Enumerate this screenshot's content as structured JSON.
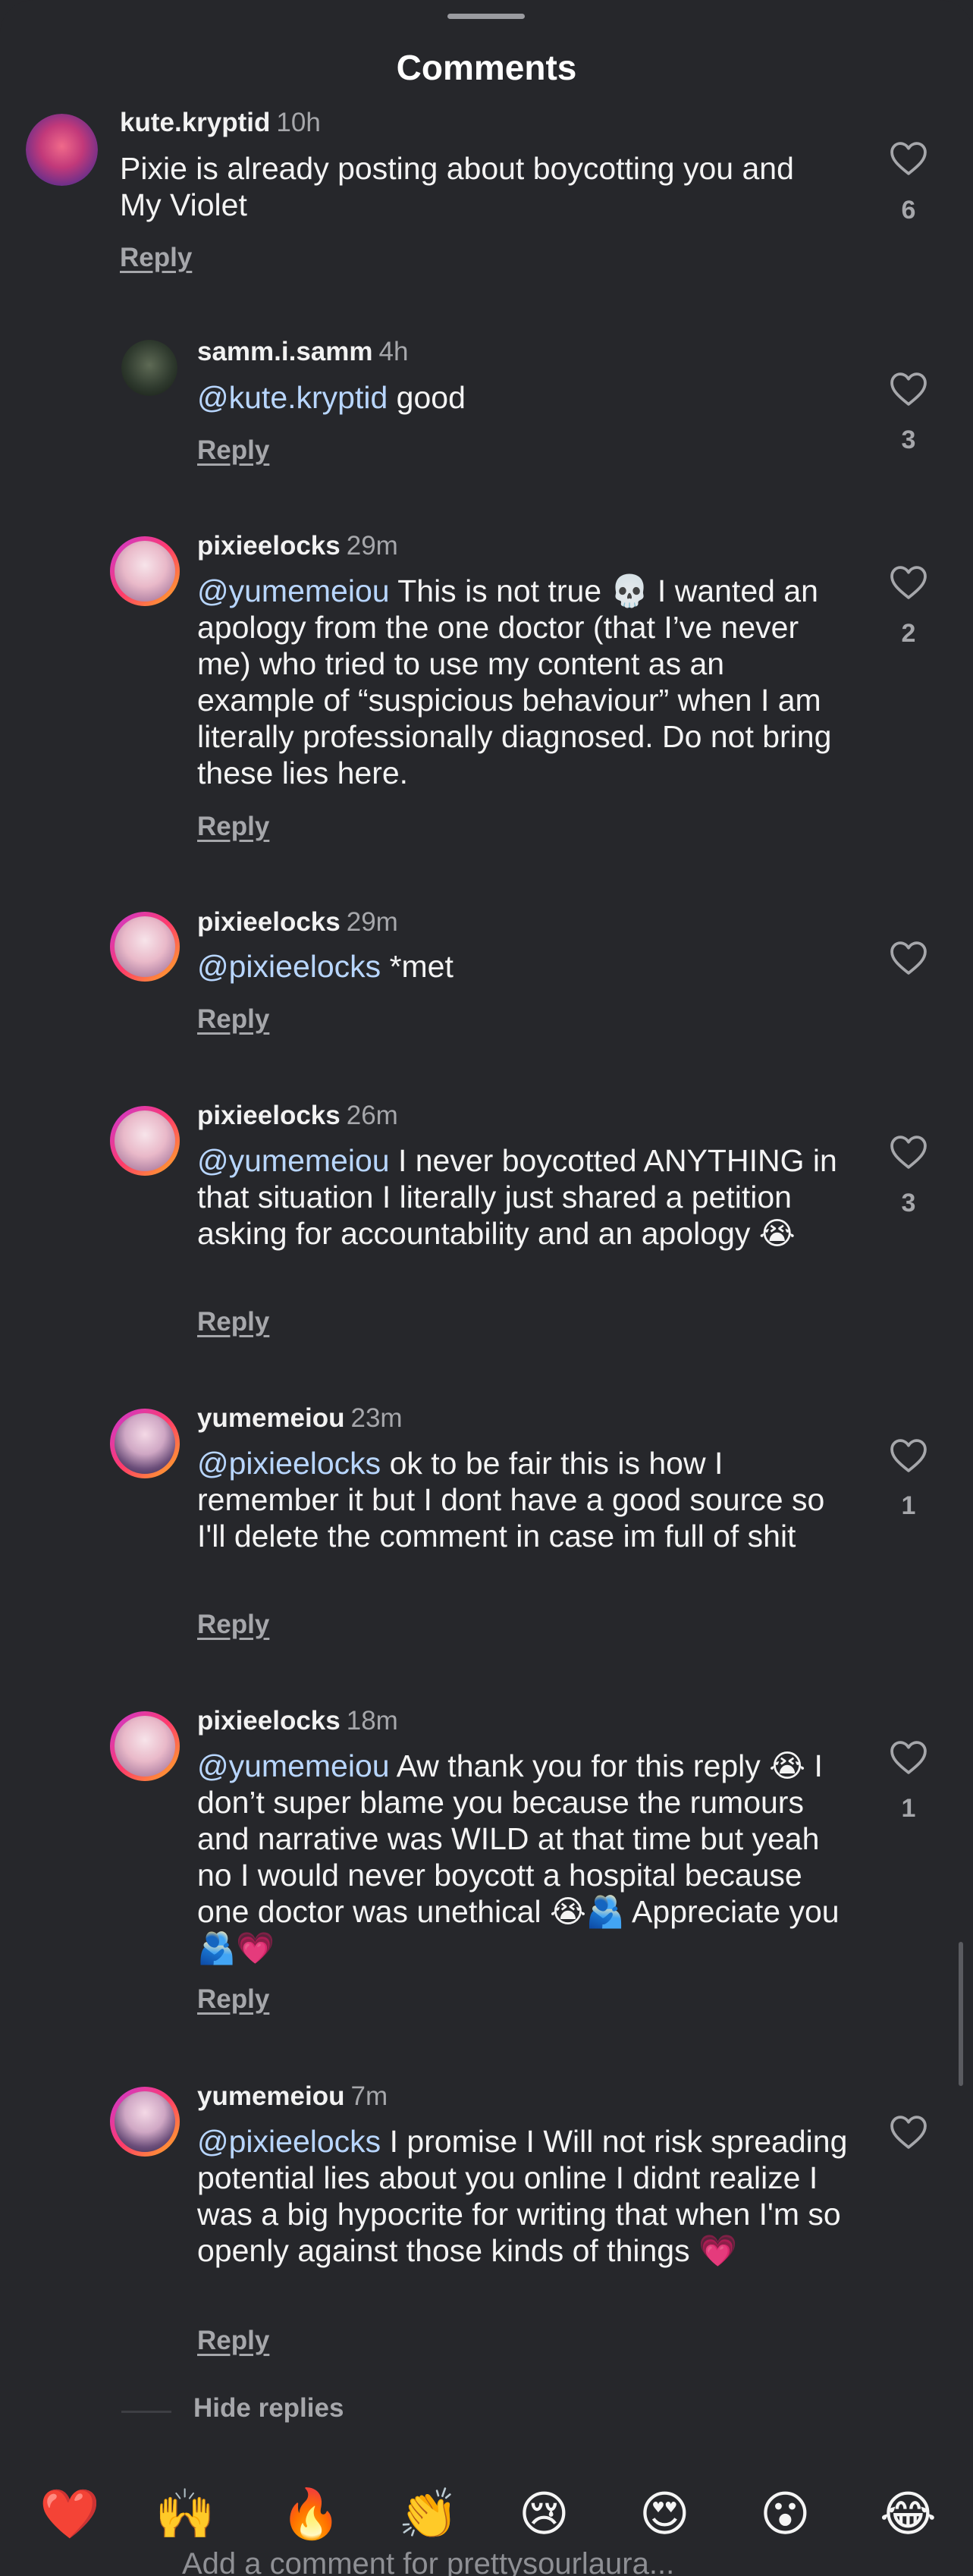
{
  "header": {
    "title": "Comments"
  },
  "comments": [
    {
      "user": "kute.kryptid",
      "time": "10h",
      "mention": "",
      "text": "Pixie is already posting about boycotting you and My Violet",
      "reply": "Reply",
      "likes": "6"
    },
    {
      "user": "samm.i.samm",
      "time": "4h",
      "mention": "@kute.kryptid",
      "text": "good",
      "reply": "Reply",
      "likes": "3"
    },
    {
      "user": "pixieelocks",
      "time": "29m",
      "mention": "@yumemeiou",
      "text": "This is not true 💀 I wanted an apology from the one doctor (that I’ve never me) who tried to use my content as an example of “suspicious behaviour” when I am literally professionally diagnosed. Do not bring these lies here.",
      "reply": "Reply",
      "likes": "2"
    },
    {
      "user": "pixieelocks",
      "time": "29m",
      "mention": "@pixieelocks",
      "text": "*met",
      "reply": "Reply",
      "likes": ""
    },
    {
      "user": "pixieelocks",
      "time": "26m",
      "mention": "@yumemeiou",
      "text": "I never boycotted ANYTHING in that situation I literally just shared a petition asking for accountability and an apology 😭",
      "reply": "Reply",
      "likes": "3"
    },
    {
      "user": "yumemeiou",
      "time": "23m",
      "mention": "@pixieelocks",
      "text": "ok to be fair this is how I remember it but I dont have a good source so I'll delete the comment in case im full of shit",
      "reply": "Reply",
      "likes": "1"
    },
    {
      "user": "pixieelocks",
      "time": "18m",
      "mention": "@yumemeiou",
      "text": "Aw thank you for this reply 😭 I don’t super blame you because the rumours and narrative was WILD at that time but yeah no I would never boycott a hospital because one doctor was unethical 😭🫂 Appreciate you 🫂💗",
      "reply": "Reply",
      "likes": "1"
    },
    {
      "user": "yumemeiou",
      "time": "7m",
      "mention": "@pixieelocks",
      "text": "I promise I Will not risk spreading potential lies about you online I didnt realize I was a big hypocrite for writing that when I'm so openly against those kinds of things 💗",
      "reply": "Reply",
      "likes": ""
    }
  ],
  "hide_replies": "Hide replies",
  "quick_reactions": [
    "❤️",
    "🙌",
    "🔥",
    "👏",
    "😢",
    "😍",
    "😮",
    "😂"
  ],
  "composer": {
    "placeholder": "Add a comment for prettysourlaura..."
  },
  "colors": {
    "background": "#26272b",
    "mention": "#b8d6ff",
    "muted": "#a6a7ab",
    "text": "#f4f4f4"
  }
}
